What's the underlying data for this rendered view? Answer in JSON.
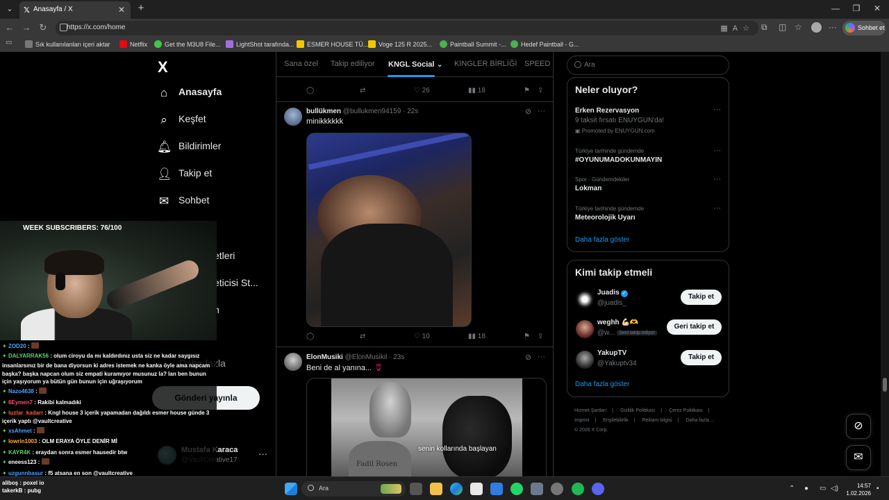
{
  "browser": {
    "tab_title": "Anasayfa / X",
    "url": "https://x.com/home",
    "chat_button": "Sohbet et",
    "bookmarks": [
      {
        "label": "Sık kullanılanları içeri aktar",
        "color": "#888888"
      },
      {
        "label": "Netflix",
        "color": "#e50914"
      },
      {
        "label": "Get the M3U8 File...",
        "color": "#3ec74a"
      },
      {
        "label": "LightShot tarafında...",
        "color": "#a070e0"
      },
      {
        "label": "ESMER HOUSE TÜ...",
        "color": "#f2c700"
      },
      {
        "label": "Voge 125 R 2025...",
        "color": "#f2c700"
      },
      {
        "label": "Paintball Summit -...",
        "color": "#4caf50"
      },
      {
        "label": "Hedef Paintball - G...",
        "color": "#4caf50"
      }
    ]
  },
  "sidebar": {
    "logo": "X",
    "items": [
      {
        "label": "Anasayfa",
        "icon": "home-icon"
      },
      {
        "label": "Keşfet",
        "icon": "search-icon"
      },
      {
        "label": "Bildirimler",
        "icon": "bell-icon"
      },
      {
        "label": "Takip et",
        "icon": "add-user-icon"
      },
      {
        "label": "Sohbet",
        "icon": "mail-icon"
      }
    ],
    "partial_items": [
      "etleri",
      "eticisi St...",
      "n",
      "Daha fazla"
    ],
    "post_button": "Gönderi yayınla",
    "account": {
      "name": "Mustafa Karaca",
      "handle": "@VaultCreative17"
    }
  },
  "feed": {
    "tabs": [
      "Sana özel",
      "Takip ediliyor",
      "KNGL Social",
      "KINGLER BİRLİĞİ",
      "SPEED G"
    ],
    "active_tab": "KNGL Social",
    "top_actions": {
      "likes": "26",
      "views": "18"
    },
    "tweets": [
      {
        "name": "bullükmen",
        "handle": "@bullukmen94159",
        "time": "22s",
        "text": "minikkkkkk",
        "likes": "10",
        "views": "18"
      },
      {
        "name": "ElonMusiki",
        "handle": "@ElonMusikil",
        "time": "23s",
        "text": "Beni de al yanına...",
        "media_caption": "senin kollarında başlayan",
        "stone_text": "Fadil Rosen"
      }
    ]
  },
  "right": {
    "search_placeholder": "Ara",
    "trends_title": "Neler oluyor?",
    "trends": [
      {
        "context": "",
        "title": "Erken Rezervasyon",
        "sub": "9 taksit fırsatı ENUYGUN'da!",
        "promo": "Promoted by ENUYGUN.com"
      },
      {
        "context": "Türkiye tarihinde gündemde",
        "title": "#OYUNUMADOKUNMAYIN",
        "sub": "",
        "promo": ""
      },
      {
        "context": "Spor · Gündemdekiler",
        "title": "Lokman",
        "sub": "",
        "promo": ""
      },
      {
        "context": "Türkiye tarihinde gündemde",
        "title": "Meteorolojik Uyarı",
        "sub": "",
        "promo": ""
      }
    ],
    "trends_more": "Daha fazla göster",
    "follow_title": "Kimi takip etmeli",
    "follows": [
      {
        "name": "Juadis",
        "handle": "@juadis_",
        "button": "Takip et",
        "verified": true,
        "badge": ""
      },
      {
        "name": "weghh 💪🏻🫶",
        "handle": "@w...",
        "button": "Geri takip et",
        "verified": false,
        "badge": "Seni takip ediyor"
      },
      {
        "name": "YakupTV",
        "handle": "@Yakuptv34",
        "button": "Takip et",
        "verified": false,
        "badge": ""
      }
    ],
    "follow_more": "Daha fazla göster",
    "footer": [
      "Hizmet Şartları",
      "|",
      "Gizlilik Politikası",
      "|",
      "Çerez Politikası",
      "|",
      "Imprint",
      "|",
      "Erişilebilirlik",
      "|",
      "Reklam bilgisi",
      "|",
      "Daha fazla ...",
      "© 2026 X Corp."
    ]
  },
  "stream": {
    "title": "WEEK SUBSCRIBERS: 76/100",
    "chat": [
      {
        "user": "ZOD20",
        "color": "#4aa3ff",
        "msg": " : "
      },
      {
        "user": "DALYARRAK56",
        "color": "#5ad36c",
        "msg": " : olum ciroyu da mı kaldırdınız usta siz ne kadar saygısız"
      },
      {
        "user": "",
        "color": "#ffffff",
        "msg": "insanlarsınız bir de bana diyorsun ki adres istemek ne kanka öyle ama napcam"
      },
      {
        "user": "",
        "color": "#ffffff",
        "msg": "başka? başka napcan olum siz empati kuramıyor musunuz la? lan ben bunun"
      },
      {
        "user": "",
        "color": "#ffffff",
        "msg": "için yaşıyorum ya bütün gün bunun için uğraşıyorum"
      },
      {
        "user": "Nazo4638",
        "color": "#4aa3ff",
        "msg": " : "
      },
      {
        "user": "6Eymen7",
        "color": "#ff4d6d",
        "msg": " : Rakibi kalmadıki"
      },
      {
        "user": "tuzlar_kadarr",
        "color": "#ff5a36",
        "msg": " : Kngl house 3 içerik yapamadan dağıldı esmer house günde 3"
      },
      {
        "user": "",
        "color": "#ffffff",
        "msg": "içerik yaptı @vaultcreative"
      },
      {
        "user": "xsAhmet",
        "color": "#4aa3ff",
        "msg": " : "
      },
      {
        "user": "lowrin1003",
        "color": "#ffb347",
        "msg": " : OLM ERAYA ÖYLE DENİR Mİ"
      },
      {
        "user": "KAYR4K",
        "color": "#5ad36c",
        "msg": " : eraydan sonra esmer hausedir btw"
      },
      {
        "user": "eneess123",
        "color": "#ffffff",
        "msg": " : "
      },
      {
        "user": "uzgunnbasur",
        "color": "#4aa3ff",
        "msg": " : f5 atsana en son @vaultcreative"
      }
    ],
    "bottom_lines": [
      "aliboş : poxel io",
      "takerkB : pubg"
    ]
  },
  "taskbar": {
    "search_label": "Ara",
    "time": "14:57",
    "date": "1.02.2026"
  }
}
